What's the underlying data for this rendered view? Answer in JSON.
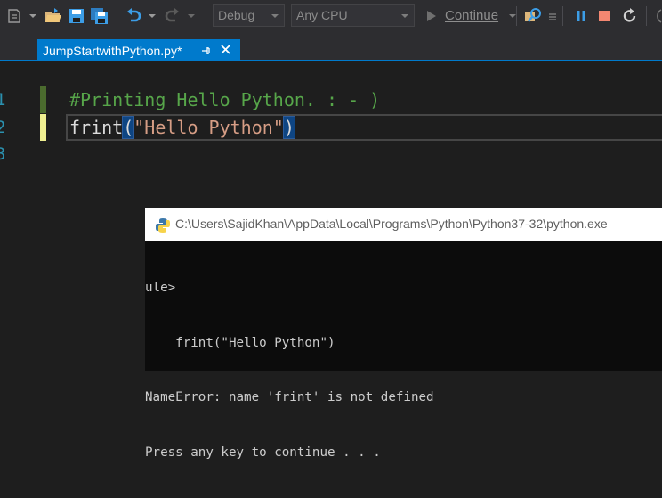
{
  "toolbar": {
    "configuration": "Debug",
    "platform": "Any CPU",
    "continue_label": "Continue",
    "icons": [
      "solution-explorer-icon",
      "open-folder-icon",
      "save-icon",
      "save-all-icon",
      "undo-icon",
      "redo-icon",
      "find-icon",
      "pause-icon",
      "stop-icon",
      "restart-icon"
    ]
  },
  "tab": {
    "title": "JumpStartwithPython.py*",
    "pin_glyph": "⊣",
    "close_glyph": "✕"
  },
  "editor": {
    "line_numbers": [
      "1",
      "2",
      "3"
    ],
    "lines": {
      "comment": "#Printing Hello Python. : - )",
      "call_name": "frint",
      "open_paren": "(",
      "string_arg": "\"Hello Python\"",
      "close_paren": ")"
    },
    "colors": {
      "comment": "#57a64a",
      "string": "#d69d85",
      "line_number": "#2b91af",
      "saved_change": "#4b6b2e",
      "unsaved_change": "#efef91"
    }
  },
  "console": {
    "title": "C:\\Users\\SajidKhan\\AppData\\Local\\Programs\\Python\\Python37-32\\python.exe",
    "output": [
      "ule>",
      "    frint(\"Hello Python\")",
      "NameError: name 'frint' is not defined",
      "Press any key to continue . . ."
    ]
  }
}
